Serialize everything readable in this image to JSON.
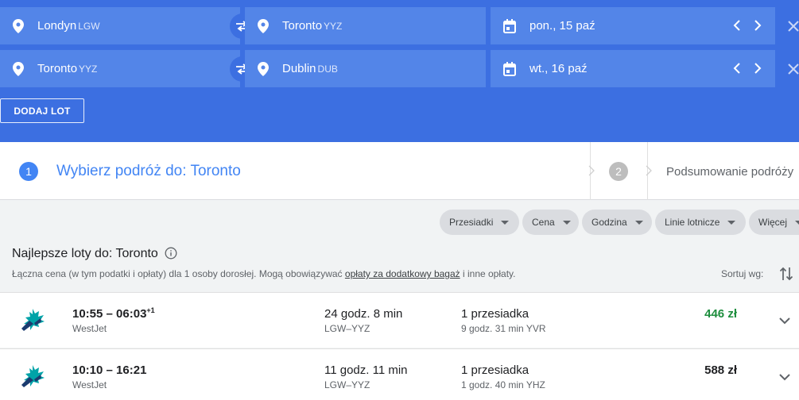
{
  "search": {
    "legs": [
      {
        "from_city": "Londyn",
        "from_code": "LGW",
        "to_city": "Toronto",
        "to_code": "YYZ",
        "date": "pon., 15 paź"
      },
      {
        "from_city": "Toronto",
        "from_code": "YYZ",
        "to_city": "Dublin",
        "to_code": "DUB",
        "date": "wt., 16 paź"
      }
    ],
    "add_flight_label": "DODAJ LOT"
  },
  "steps": {
    "step1_number": "1",
    "step1_label": "Wybierz podróż do: Toronto",
    "step2_number": "2",
    "step2_label": "Podsumowanie podróży"
  },
  "filters": [
    "Przesiadki",
    "Cena",
    "Godzina",
    "Linie lotnicze",
    "Więcej"
  ],
  "results": {
    "title": "Najlepsze loty do: Toronto",
    "note_before": "Łączna cena (w tym podatki i opłaty) dla 1 osoby dorosłej. Mogą obowiązywać ",
    "note_link": "opłaty za dodatkowy bagaż",
    "note_after": " i inne opłaty.",
    "sort_label": "Sortuj wg:",
    "flights": [
      {
        "times": "10:55 – 06:03",
        "day_offset": "+1",
        "airline": "WestJet",
        "duration": "24 godz. 8 min",
        "route": "LGW–YYZ",
        "stops": "1 przesiadka",
        "layover": "9 godz. 31 min YVR",
        "price": "446 zł",
        "price_color": "#1e8e3e"
      },
      {
        "times": "10:10 – 16:21",
        "day_offset": "",
        "airline": "WestJet",
        "duration": "11 godz. 11 min",
        "route": "LGW–YYZ",
        "stops": "1 przesiadka",
        "layover": "1 godz. 40 min YHZ",
        "price": "588 zł",
        "price_color": "#202124"
      }
    ]
  },
  "colors": {
    "header_bg": "#3c6fe1",
    "field_bg": "#5385e8",
    "accent": "#4285f4",
    "westjet_teal": "#00a3a8",
    "westjet_navy": "#1b3b6f"
  }
}
